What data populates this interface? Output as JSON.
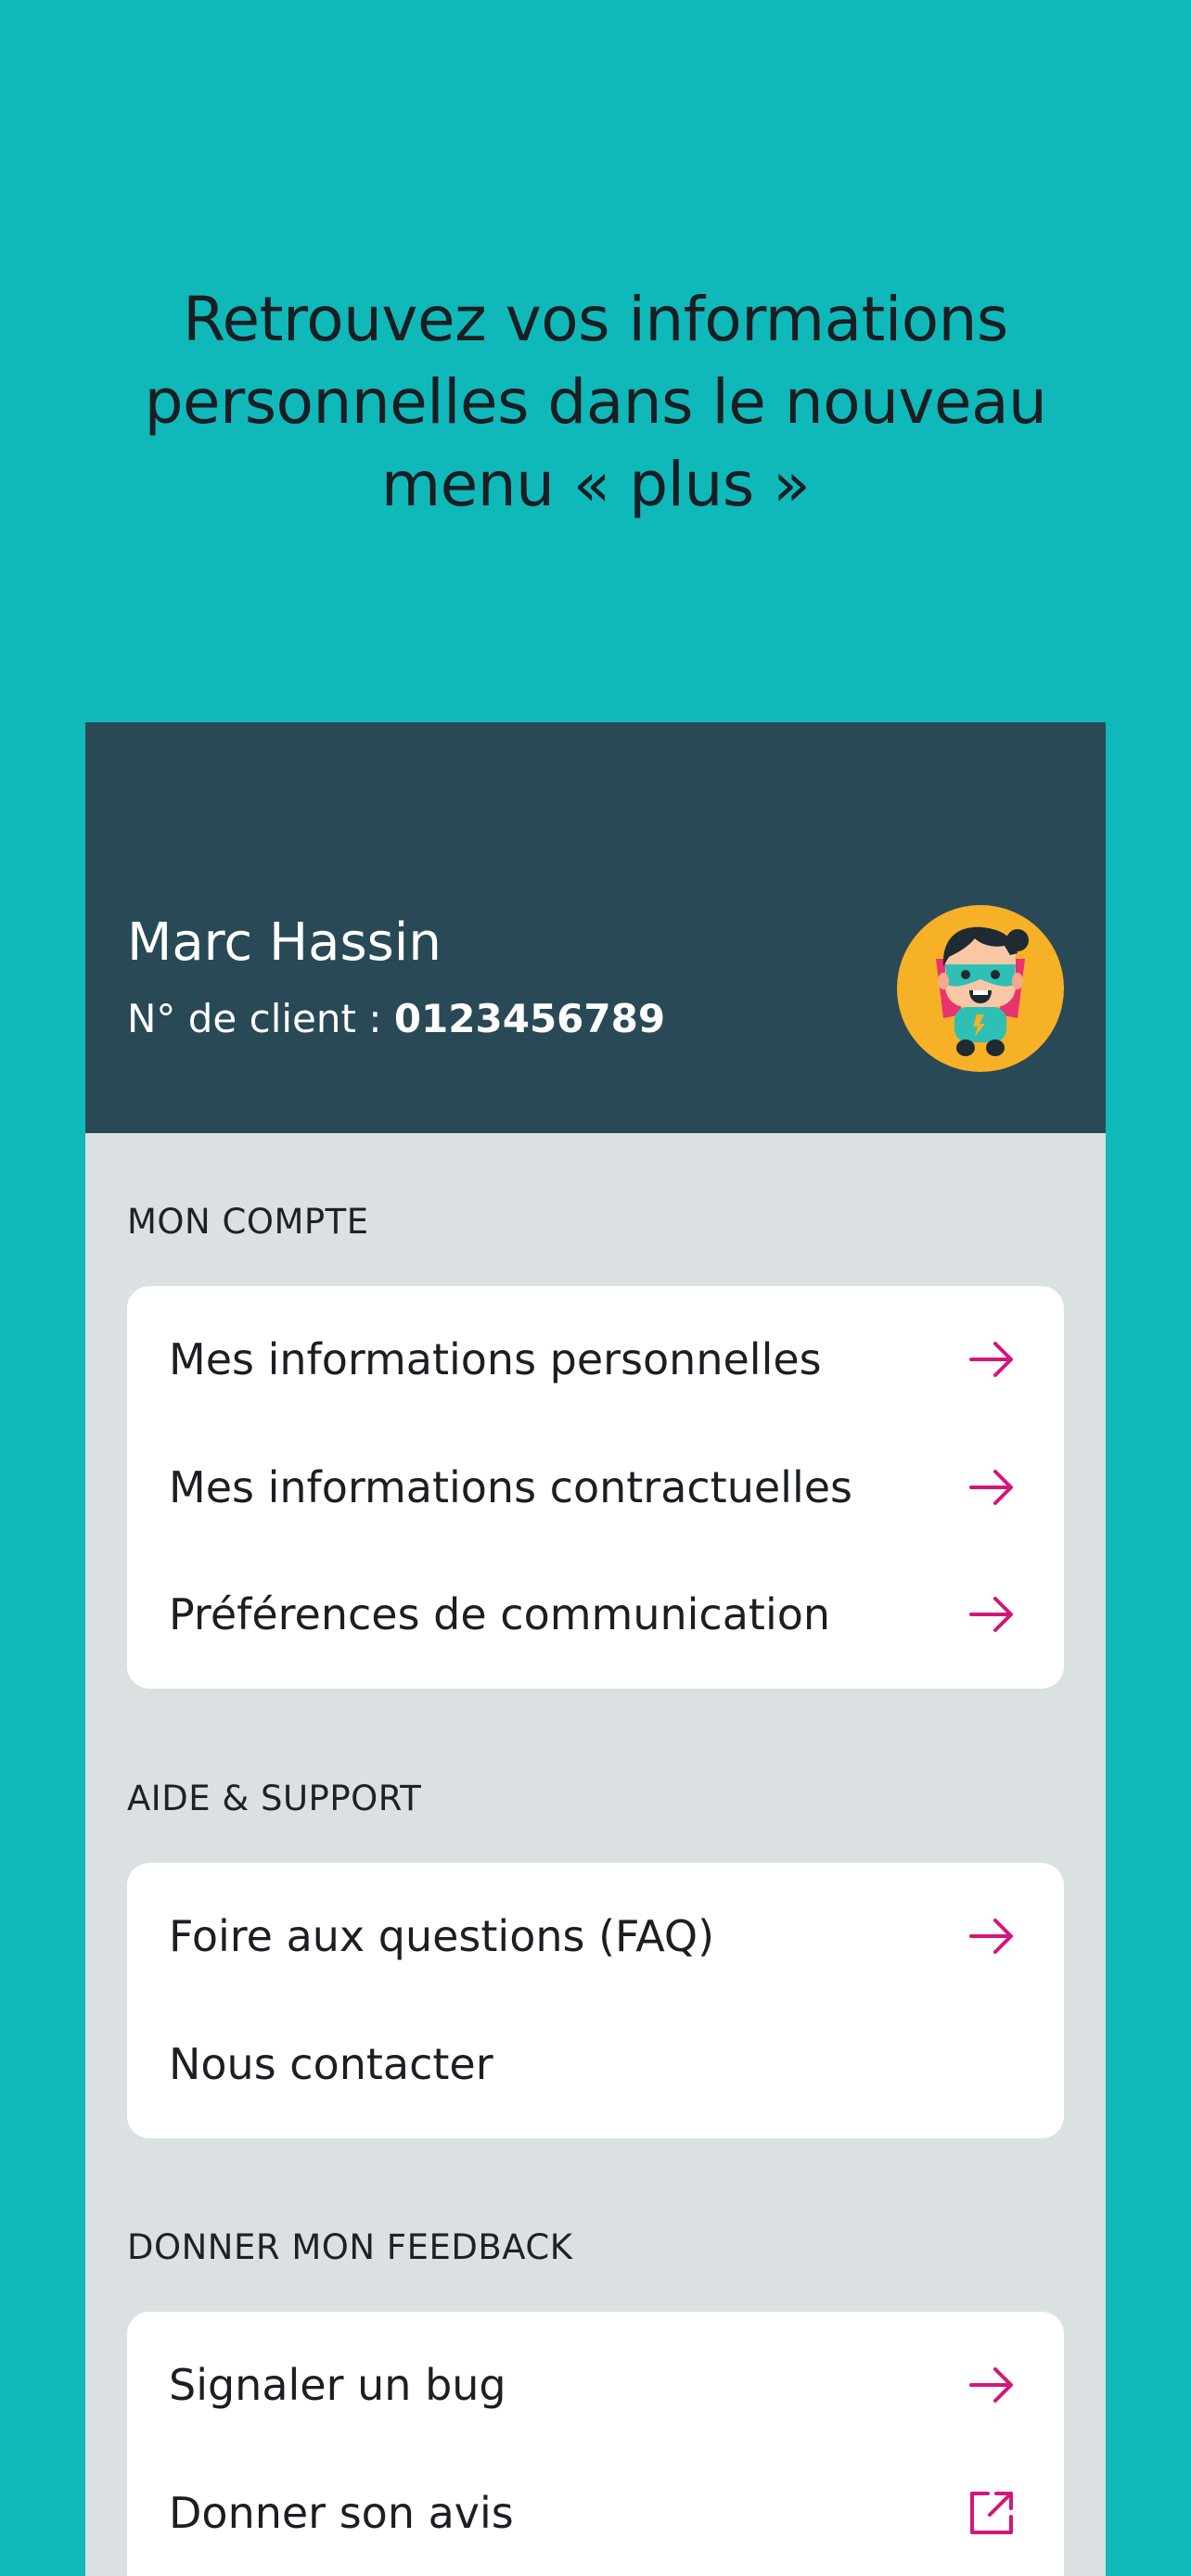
{
  "headline": {
    "line1": "Retrouvez vos informations",
    "line2": "personnelles dans le nouveau",
    "line3": "menu « plus »"
  },
  "profile": {
    "name": "Marc Hassin",
    "client_label": "N° de client : ",
    "client_number": "0123456789",
    "avatar_icon": "superhero-avatar-icon"
  },
  "colors": {
    "background": "#10b9b9",
    "header": "#294957",
    "panel": "#dbe0e3",
    "accent": "#d6157a"
  },
  "sections": {
    "account": {
      "title": "MON COMPTE",
      "items": [
        {
          "label": "Mes informations personnelles",
          "icon": "arrow-right-icon"
        },
        {
          "label": "Mes informations contractuelles",
          "icon": "arrow-right-icon"
        },
        {
          "label": "Préférences de communication",
          "icon": "arrow-right-icon"
        }
      ]
    },
    "help": {
      "title": "AIDE & SUPPORT",
      "items": [
        {
          "label": "Foire aux questions (FAQ)",
          "icon": "arrow-right-icon"
        },
        {
          "label": "Nous contacter",
          "icon": ""
        }
      ]
    },
    "feedback": {
      "title": "DONNER MON FEEDBACK",
      "items": [
        {
          "label": "Signaler un bug",
          "icon": "arrow-right-icon"
        },
        {
          "label": "Donner son avis",
          "icon": "external-link-icon"
        }
      ]
    }
  }
}
